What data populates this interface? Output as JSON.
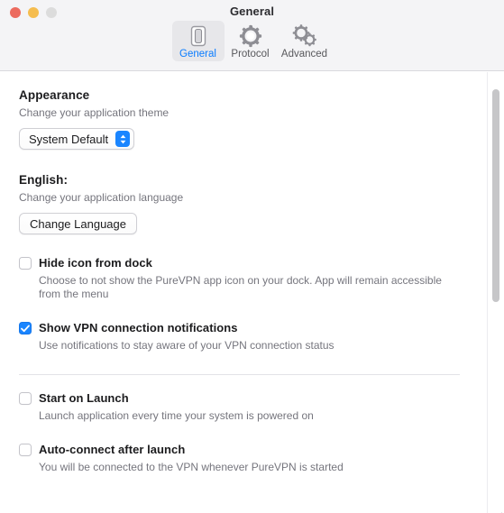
{
  "window": {
    "title": "General",
    "traffic_lights": [
      {
        "name": "close",
        "color": "#ec6a5e"
      },
      {
        "name": "minimize",
        "color": "#f5bd4f"
      },
      {
        "name": "zoom",
        "color": "#dcdcdc"
      }
    ]
  },
  "toolbar": {
    "tabs": [
      {
        "label": "General",
        "icon": "toggle-switch-icon",
        "selected": true
      },
      {
        "label": "Protocol",
        "icon": "gear-icon",
        "selected": false
      },
      {
        "label": "Advanced",
        "icon": "double-gear-icon",
        "selected": false
      }
    ]
  },
  "main": {
    "appearance": {
      "title": "Appearance",
      "description": "Change your application theme",
      "popup_value": "System Default",
      "popup_options": [
        "System Default"
      ]
    },
    "language": {
      "title": "English:",
      "description": "Change your application language",
      "button_label": "Change Language"
    },
    "options_group_1": [
      {
        "label": "Hide icon from dock",
        "description": "Choose to not show the PureVPN app icon on your dock. App will remain accessible from the menu",
        "checked": false
      },
      {
        "label": "Show VPN connection notifications",
        "description": "Use notifications to stay aware of your VPN connection status",
        "checked": true
      }
    ],
    "options_group_2": [
      {
        "label": "Start on Launch",
        "description": "Launch application every time your system is powered on",
        "checked": false
      },
      {
        "label": "Auto-connect after launch",
        "description": "You will be connected to the VPN whenever PureVPN is started",
        "checked": false
      }
    ]
  },
  "colors": {
    "accent": "#1a85ff",
    "tab_selected_text": "#0a7cff",
    "title_text": "#1c1c1e",
    "secondary_text": "#75757d",
    "toolbar_bg": "#f4f4f6",
    "tab_selected_bg": "#e7e7ea"
  },
  "scrollbar": {
    "orientation": "vertical",
    "thumb_position_pct": 4,
    "thumb_size_pct": 48
  }
}
